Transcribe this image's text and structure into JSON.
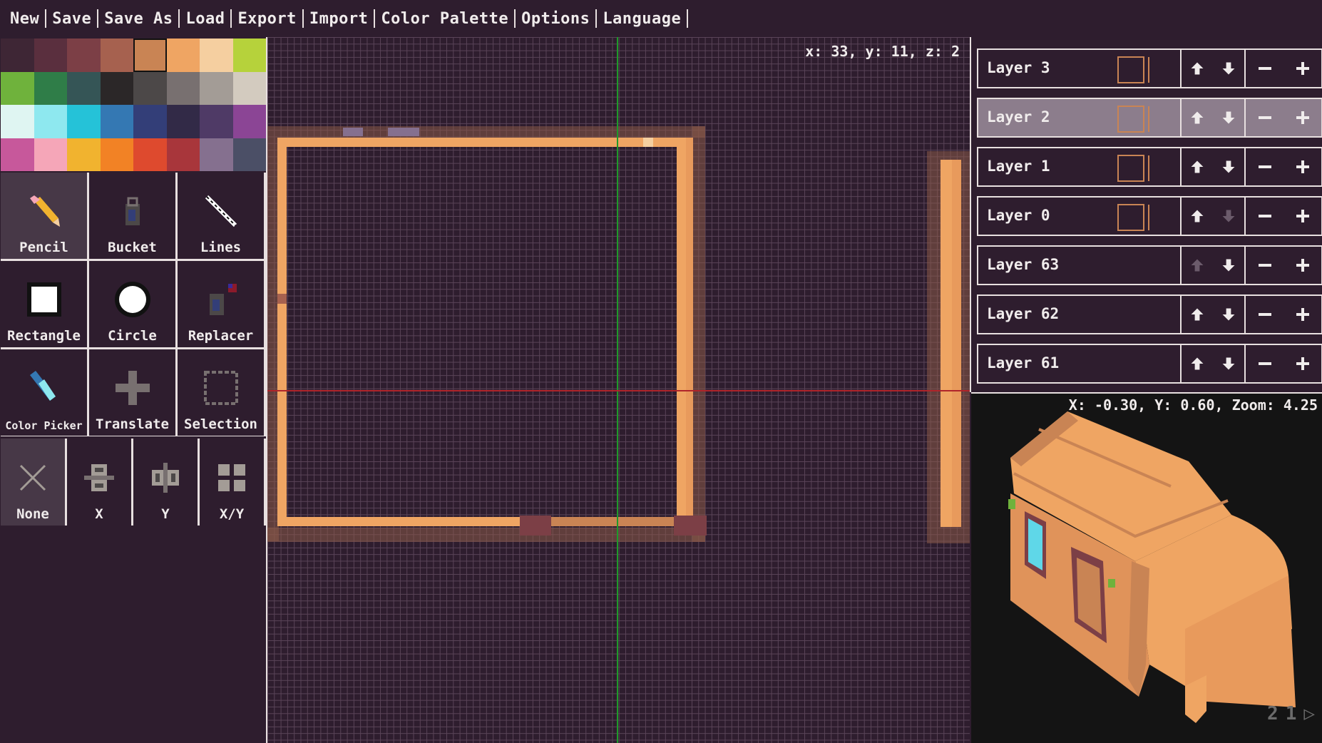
{
  "menu": {
    "items": [
      "New",
      "Save",
      "Save As",
      "Load",
      "Export",
      "Import",
      "Color Palette",
      "Options",
      "Language"
    ]
  },
  "palette": {
    "colors": [
      "#3e2635",
      "#5a2f3e",
      "#7c3f46",
      "#a6614f",
      "#c98454",
      "#efa563",
      "#f5cfa0",
      "#b6d23b",
      "#6fb23c",
      "#2f7d48",
      "#355556",
      "#2b2728",
      "#4c4848",
      "#787070",
      "#a39c96",
      "#d3cbbf",
      "#dff5f2",
      "#8ee8ef",
      "#25c2d8",
      "#3478b3",
      "#333e78",
      "#322a47",
      "#4f3a66",
      "#8b4595",
      "#c7589b",
      "#f5a6b8",
      "#f1b32f",
      "#f28225",
      "#de4a2e",
      "#a8363b",
      "#85708f",
      "#4b4f66"
    ],
    "selected_index": 4
  },
  "tools": {
    "items": [
      {
        "label": "Pencil",
        "icon": "pencil-icon",
        "active": true
      },
      {
        "label": "Bucket",
        "icon": "bucket-icon",
        "active": false
      },
      {
        "label": "Lines",
        "icon": "lines-icon",
        "active": false
      },
      {
        "label": "Rectangle",
        "icon": "rectangle-icon",
        "active": false
      },
      {
        "label": "Circle",
        "icon": "circle-icon",
        "active": false
      },
      {
        "label": "Replacer",
        "icon": "replacer-icon",
        "active": false
      },
      {
        "label": "Color Picker",
        "icon": "color-picker-icon",
        "active": false
      },
      {
        "label": "Translate",
        "icon": "translate-icon",
        "active": false
      },
      {
        "label": "Selection",
        "icon": "selection-icon",
        "active": false
      }
    ],
    "mirrors": [
      {
        "label": "None",
        "icon": "mirror-none-icon",
        "active": true
      },
      {
        "label": "X",
        "icon": "mirror-x-icon",
        "active": false
      },
      {
        "label": "Y",
        "icon": "mirror-y-icon",
        "active": false
      },
      {
        "label": "X/Y",
        "icon": "mirror-xy-icon",
        "active": false
      }
    ]
  },
  "canvas": {
    "coords": "x: 33, y: 11, z: 2",
    "colors": {
      "wall": "#efa563",
      "wall_shadow": "#a06a4a",
      "axis_x": "#b0242a",
      "axis_y": "#1f9a2a"
    }
  },
  "layers": [
    {
      "name": "Layer 3",
      "has_thumb": true,
      "active": false,
      "up_enabled": true,
      "down_enabled": true
    },
    {
      "name": "Layer 2",
      "has_thumb": true,
      "active": true,
      "up_enabled": true,
      "down_enabled": true
    },
    {
      "name": "Layer 1",
      "has_thumb": true,
      "active": false,
      "up_enabled": true,
      "down_enabled": true
    },
    {
      "name": "Layer 0",
      "has_thumb": true,
      "active": false,
      "up_enabled": true,
      "down_enabled": false
    },
    {
      "name": "Layer 63",
      "has_thumb": false,
      "active": false,
      "up_enabled": false,
      "down_enabled": true
    },
    {
      "name": "Layer 62",
      "has_thumb": false,
      "active": false,
      "up_enabled": true,
      "down_enabled": true
    },
    {
      "name": "Layer 61",
      "has_thumb": false,
      "active": false,
      "up_enabled": true,
      "down_enabled": true
    }
  ],
  "preview": {
    "readout": "X: -0.30, Y: 0.60, Zoom: 4.25",
    "playback": [
      "2",
      "1",
      "▷"
    ]
  }
}
